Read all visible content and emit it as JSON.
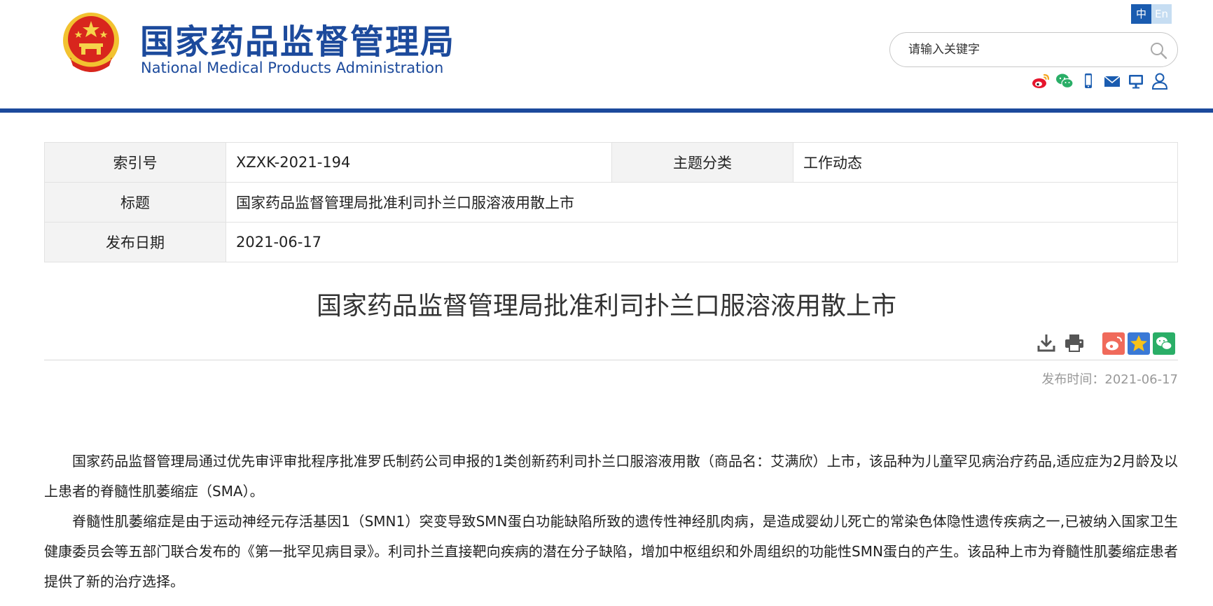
{
  "header": {
    "logo_cn": "国家药品监督管理局",
    "logo_en": "National Medical Products Administration",
    "lang_zh": "中",
    "lang_en": "En",
    "search_placeholder": "请输入关键字",
    "icons": [
      "weibo-icon",
      "wechat-icon",
      "mobile-icon",
      "mail-icon",
      "monitor-icon",
      "user-icon"
    ]
  },
  "info": {
    "index_label": "索引号",
    "index_value": "XZXK-2021-194",
    "category_label": "主题分类",
    "category_value": "工作动态",
    "title_label": "标题",
    "title_value": "国家药品监督管理局批准利司扑兰口服溶液用散上市",
    "date_label": "发布日期",
    "date_value": "2021-06-17"
  },
  "article": {
    "title": "国家药品监督管理局批准利司扑兰口服溶液用散上市",
    "pubtime": "发布时间：2021-06-17",
    "paragraphs": [
      "国家药品监督管理局通过优先审评审批程序批准罗氏制药公司申报的1类创新药利司扑兰口服溶液用散（商品名：艾满欣）上市，该品种为儿童罕见病治疗药品,适应症为2月龄及以上患者的脊髓性肌萎缩症（SMA）。",
      "脊髓性肌萎缩症是由于运动神经元存活基因1（SMN1）突变导致SMN蛋白功能缺陷所致的遗传性神经肌肉病，是造成婴幼儿死亡的常染色体隐性遗传疾病之一,已被纳入国家卫生健康委员会等五部门联合发布的《第一批罕见病目录》。利司扑兰直接靶向疾病的潜在分子缺陷，增加中枢组织和外周组织的功能性SMN蛋白的产生。该品种上市为脊髓性肌萎缩症患者提供了新的治疗选择。"
    ]
  },
  "colors": {
    "brand_blue": "#1c4a9c",
    "lang_active": "#1a5cb0",
    "weibo_red": "#e6162d",
    "wechat_green": "#2aae67"
  }
}
